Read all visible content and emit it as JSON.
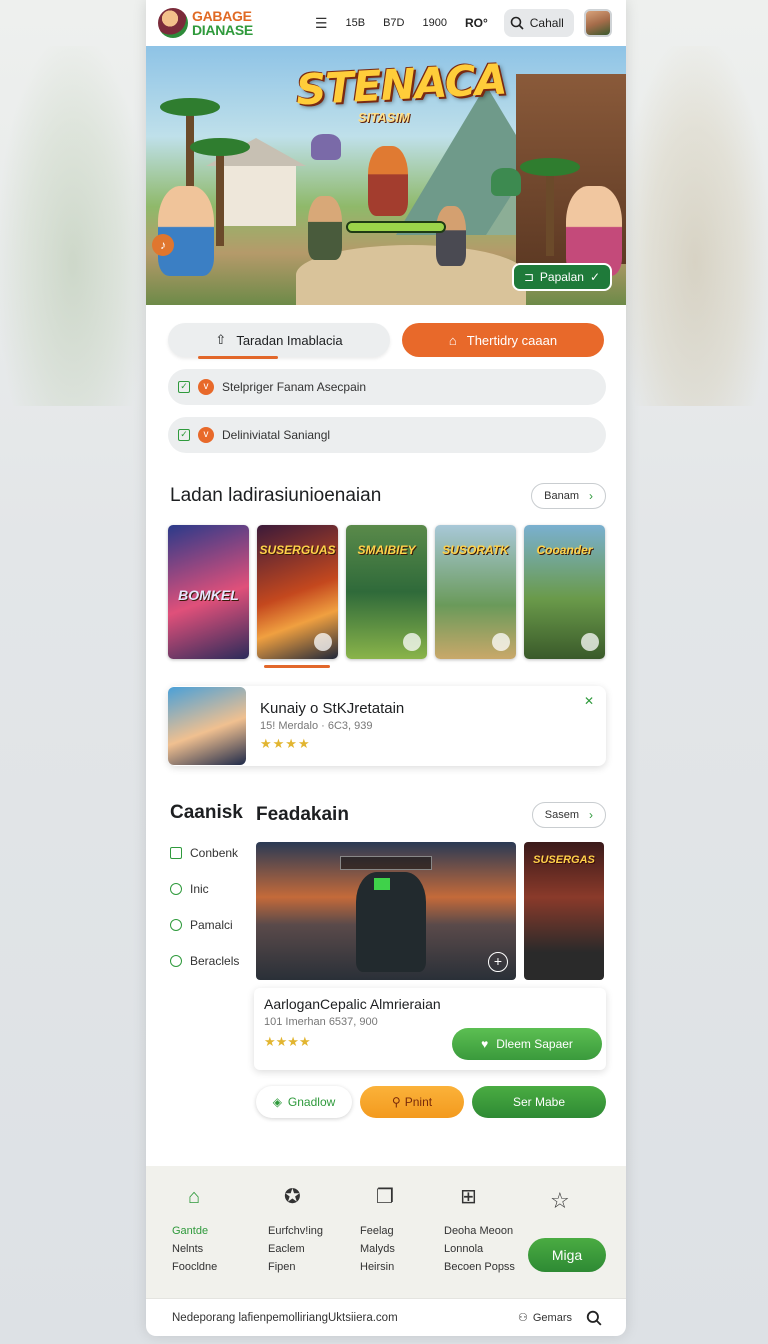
{
  "header": {
    "logo_line1": "GABAGE",
    "logo_line2": "DIANASE",
    "nav_items": [
      "15B",
      "B7D",
      "1900",
      "RO°"
    ],
    "search_label": "Cahall"
  },
  "hero": {
    "title": "STENACA",
    "subtitle": "SITASIM",
    "button_label": "Papalan"
  },
  "actions": {
    "gray_label": "Taradan Imablacia",
    "orange_label": "Thertidry caaan"
  },
  "checklist": [
    {
      "label": "Stelpriger Fanam Asecpain"
    },
    {
      "label": "Deliniviatal Saniangl"
    }
  ],
  "section1": {
    "title": "Ladan ladirasiunioenaian",
    "button_label": "Banam",
    "thumbnails": [
      {
        "label": "BOMKEL"
      },
      {
        "label": "SUSERGUAS"
      },
      {
        "label": "SMAIBIEY"
      },
      {
        "label": "SUSORATK"
      },
      {
        "label": "Cooander"
      }
    ]
  },
  "featured": {
    "title": "Kunaiy o StKJretatain",
    "meta": "15! Merdalo · 6C3, 939",
    "stars": "★★★★",
    "rating_icon": "x-mark"
  },
  "categories": {
    "title": "Caanisk",
    "items": [
      "Conbenk",
      "Inic",
      "Pamalci",
      "Beraclels"
    ]
  },
  "section2": {
    "title": "Feadakain",
    "button_label": "Sasem",
    "media_side_label": "SUSERGAS",
    "card_title": "AarloganCepalic Almrieraian",
    "card_meta": "101 Imerhan 6537, 900",
    "card_stars": "★★★★",
    "card_button": "Dleem Sapaer"
  },
  "buttons": {
    "b1": "Gnadlow",
    "b2": "Pnint",
    "b3": "Ser Mabe"
  },
  "bottom_nav": {
    "columns": [
      {
        "icon": "home-icon",
        "lines": [
          "Gantde",
          "Nelnts",
          "Foocldne"
        ]
      },
      {
        "icon": "badge-star-icon",
        "lines": [
          "Eurfchv!ing",
          "Eaclem",
          "Fipen"
        ]
      },
      {
        "icon": "cards-icon",
        "lines": [
          "Feelag",
          "Malyds",
          "Heirsin"
        ]
      },
      {
        "icon": "bag-icon",
        "lines": [
          "Deoha Meoon",
          "Lonnola",
          "Becoen Popss"
        ]
      }
    ],
    "cta_label": "Miga"
  },
  "footer": {
    "text": "Nedeporang lafienpemolliriangUktsiiera.com",
    "games_label": "Gemars"
  },
  "colors": {
    "accent_orange": "#e8692a",
    "accent_green": "#2f9a3c",
    "star_gold": "#e2b530"
  }
}
